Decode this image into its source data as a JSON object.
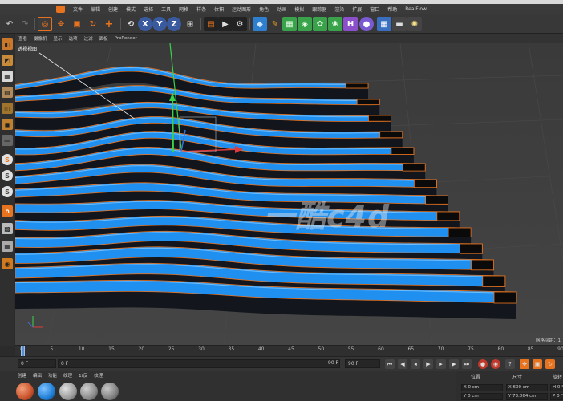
{
  "menubar": {
    "items": [
      "文件",
      "编辑",
      "创建",
      "模式",
      "选择",
      "工具",
      "网格",
      "样条",
      "体积",
      "运动图形",
      "角色",
      "动画",
      "模拟",
      "跟踪器",
      "渲染",
      "扩展",
      "窗口",
      "帮助",
      "RealFlow"
    ]
  },
  "viewport_menu": {
    "items": [
      "查看",
      "摄像机",
      "显示",
      "选项",
      "过滤",
      "面板",
      "ProRender"
    ]
  },
  "viewport": {
    "label": "透视视图",
    "watermark": "一酷c4d",
    "status": "网格间距：1"
  },
  "timeline": {
    "ticks": [
      "0",
      "5",
      "10",
      "15",
      "20",
      "25",
      "30",
      "35",
      "40",
      "45",
      "50",
      "55",
      "60",
      "65",
      "70",
      "75",
      "80",
      "85",
      "90"
    ],
    "current_frame": 0
  },
  "transport": {
    "start_field": "0 F",
    "min_field": "0 F",
    "end_field": "90 F",
    "max_field": "90 F"
  },
  "materials": {
    "tabs": [
      "创建",
      "编辑",
      "功能",
      "纹理",
      "1t反",
      "纹理"
    ],
    "swatches": [
      "#d8643f",
      "#1e7fd6",
      "#9a9a9a",
      "#8a8a8a",
      "#808080"
    ]
  },
  "coordinates": {
    "position_label": "位置",
    "size_label": "尺寸",
    "rotation_label": "旋转",
    "x_pos": "X 0 cm",
    "y_pos": "Y 0 cm",
    "x_size": "X 600 cm",
    "y_size": "Y 73.064 cm",
    "h_rot": "H 0 °",
    "p_rot": "P 0 °"
  },
  "colors": {
    "accent": "#e8731f",
    "wave_blue": "#1f8ff0",
    "axis_x": "#e03a3a",
    "axis_y": "#39d34a",
    "axis_z": "#3a6fe0"
  },
  "icons": {
    "toolbar": [
      "undo-icon",
      "redo-icon",
      "live-select-icon",
      "move-icon",
      "scale-icon",
      "rotate-icon",
      "add-icon",
      "x-axis-icon",
      "y-axis-icon",
      "z-axis-icon",
      "coordinate-system-icon",
      "render-view-icon",
      "render-picture-icon",
      "render-settings-icon",
      "cube-icon",
      "pen-icon",
      "subdivision-icon",
      "array-icon",
      "cloner-icon",
      "deformer-icon",
      "floor-icon",
      "camera-icon",
      "light-icon"
    ]
  }
}
